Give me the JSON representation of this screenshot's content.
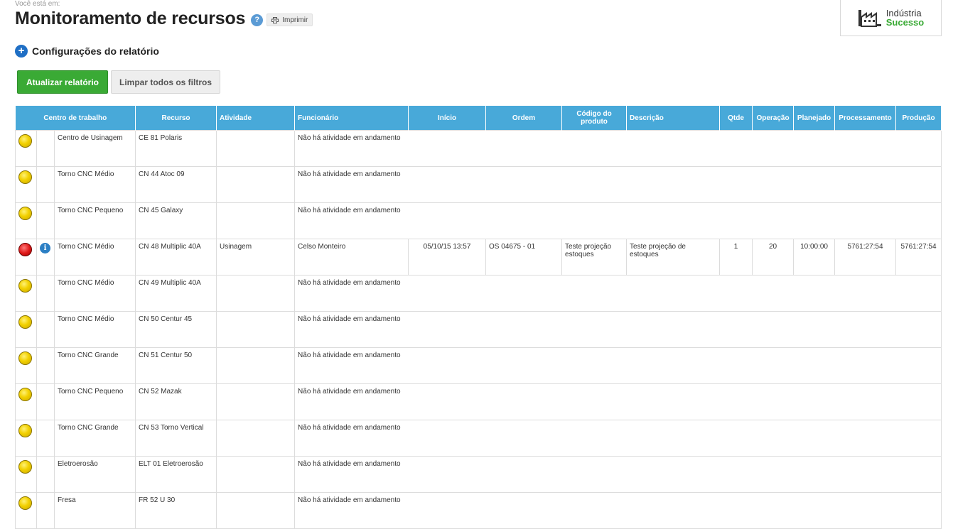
{
  "breadcrumb": {
    "label": "Você está em:"
  },
  "page": {
    "title": "Monitoramento de recursos",
    "help_glyph": "?",
    "print_label": "Imprimir"
  },
  "logo": {
    "line1": "Indústria",
    "line2": "Sucesso"
  },
  "config": {
    "label": "Configurações do relatório",
    "plus_glyph": "+"
  },
  "buttons": {
    "update": "Atualizar relatório",
    "clear": "Limpar todos os filtros"
  },
  "colors": {
    "header_bg": "#48a9d9",
    "update_btn": "#3aaa35",
    "status_idle": "#f2d000",
    "status_active": "#e01b1b",
    "info": "#2c7fc4"
  },
  "table": {
    "headers": {
      "centro": "Centro de trabalho",
      "recurso": "Recurso",
      "atividade": "Atividade",
      "funcionario": "Funcionário",
      "inicio": "Início",
      "ordem": "Ordem",
      "codigo": "Código do produto",
      "descricao": "Descrição",
      "qtde": "Qtde",
      "operacao": "Operação",
      "planejado": "Planejado",
      "processamento": "Processamento",
      "producao": "Produção"
    },
    "empty_message": "Não há atividade em andamento",
    "rows": [
      {
        "status": "yellow",
        "centro": "Centro de Usinagem",
        "recurso": "CE 81 Polaris"
      },
      {
        "status": "yellow",
        "centro": "Torno CNC Médio",
        "recurso": "CN 44 Atoc 09"
      },
      {
        "status": "yellow",
        "centro": "Torno CNC Pequeno",
        "recurso": "CN 45 Galaxy"
      },
      {
        "status": "red",
        "info": "i",
        "centro": "Torno CNC Médio",
        "recurso": "CN 48 Multiplic 40A",
        "atividade": "Usinagem",
        "funcionario": "Celso Monteiro",
        "inicio": "05/10/15 13:57",
        "ordem": "OS 04675 - 01",
        "codigo": "Teste projeção estoques",
        "descricao": "Teste projeção de estoques",
        "qtde": "1",
        "operacao": "20",
        "planejado": "10:00:00",
        "processamento": "5761:27:54",
        "producao": "5761:27:54"
      },
      {
        "status": "yellow",
        "centro": "Torno CNC Médio",
        "recurso": "CN 49 Multiplic 40A"
      },
      {
        "status": "yellow",
        "centro": "Torno CNC Médio",
        "recurso": "CN 50 Centur 45"
      },
      {
        "status": "yellow",
        "centro": "Torno CNC Grande",
        "recurso": "CN 51 Centur 50"
      },
      {
        "status": "yellow",
        "centro": "Torno CNC Pequeno",
        "recurso": "CN 52 Mazak"
      },
      {
        "status": "yellow",
        "centro": "Torno CNC Grande",
        "recurso": "CN 53 Torno Vertical"
      },
      {
        "status": "yellow",
        "centro": "Eletroerosão",
        "recurso": "ELT 01 Eletroerosão"
      },
      {
        "status": "yellow",
        "centro": "Fresa",
        "recurso": "FR 52 U 30"
      }
    ]
  }
}
